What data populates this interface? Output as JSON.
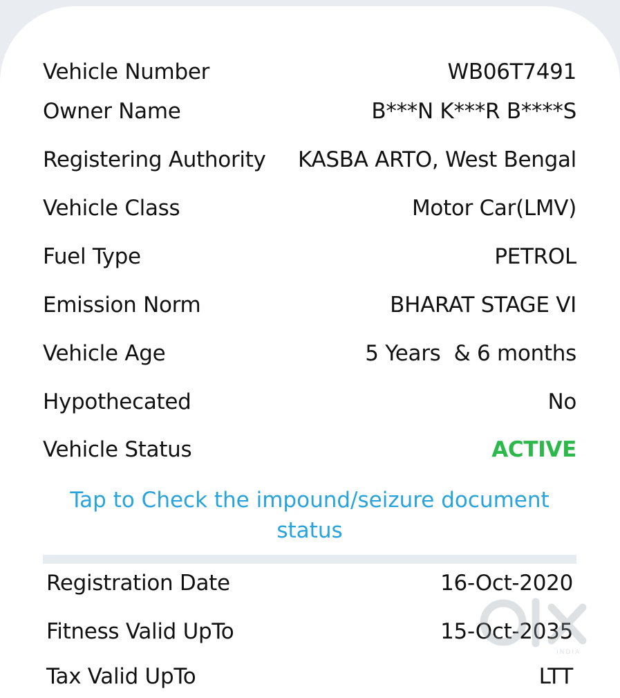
{
  "details": {
    "vehicle_number": {
      "label": "Vehicle Number",
      "value": "WB06T7491"
    },
    "owner_name": {
      "label": "Owner Name",
      "value": "B***N K***R B****S"
    },
    "registering_authority": {
      "label": "Registering Authority",
      "value": "KASBA ARTO, West Bengal"
    },
    "vehicle_class": {
      "label": "Vehicle Class",
      "value": "Motor Car(LMV)"
    },
    "fuel_type": {
      "label": "Fuel Type",
      "value": "PETROL"
    },
    "emission_norm": {
      "label": "Emission Norm",
      "value": "BHARAT STAGE VI"
    },
    "vehicle_age": {
      "label": "Vehicle Age",
      "value": "5 Years  & 6 months"
    },
    "hypothecated": {
      "label": "Hypothecated",
      "value": "No"
    },
    "vehicle_status": {
      "label": "Vehicle Status",
      "value": "ACTIVE",
      "color": "#2db84b"
    }
  },
  "impound_link": {
    "line1": "Tap to Check the impound/seizure document",
    "line2": "status",
    "color": "#27a3dd"
  },
  "dates": {
    "registration_date": {
      "label": "Registration Date",
      "value": "16-Oct-2020"
    },
    "fitness_valid_upto": {
      "label": "Fitness Valid UpTo",
      "value": "15-Oct-2035"
    },
    "tax_valid_upto": {
      "label": "Tax Valid UpTo",
      "value": "LTT"
    }
  },
  "watermark": {
    "icon": "olx-logo",
    "text": "INDIA"
  }
}
